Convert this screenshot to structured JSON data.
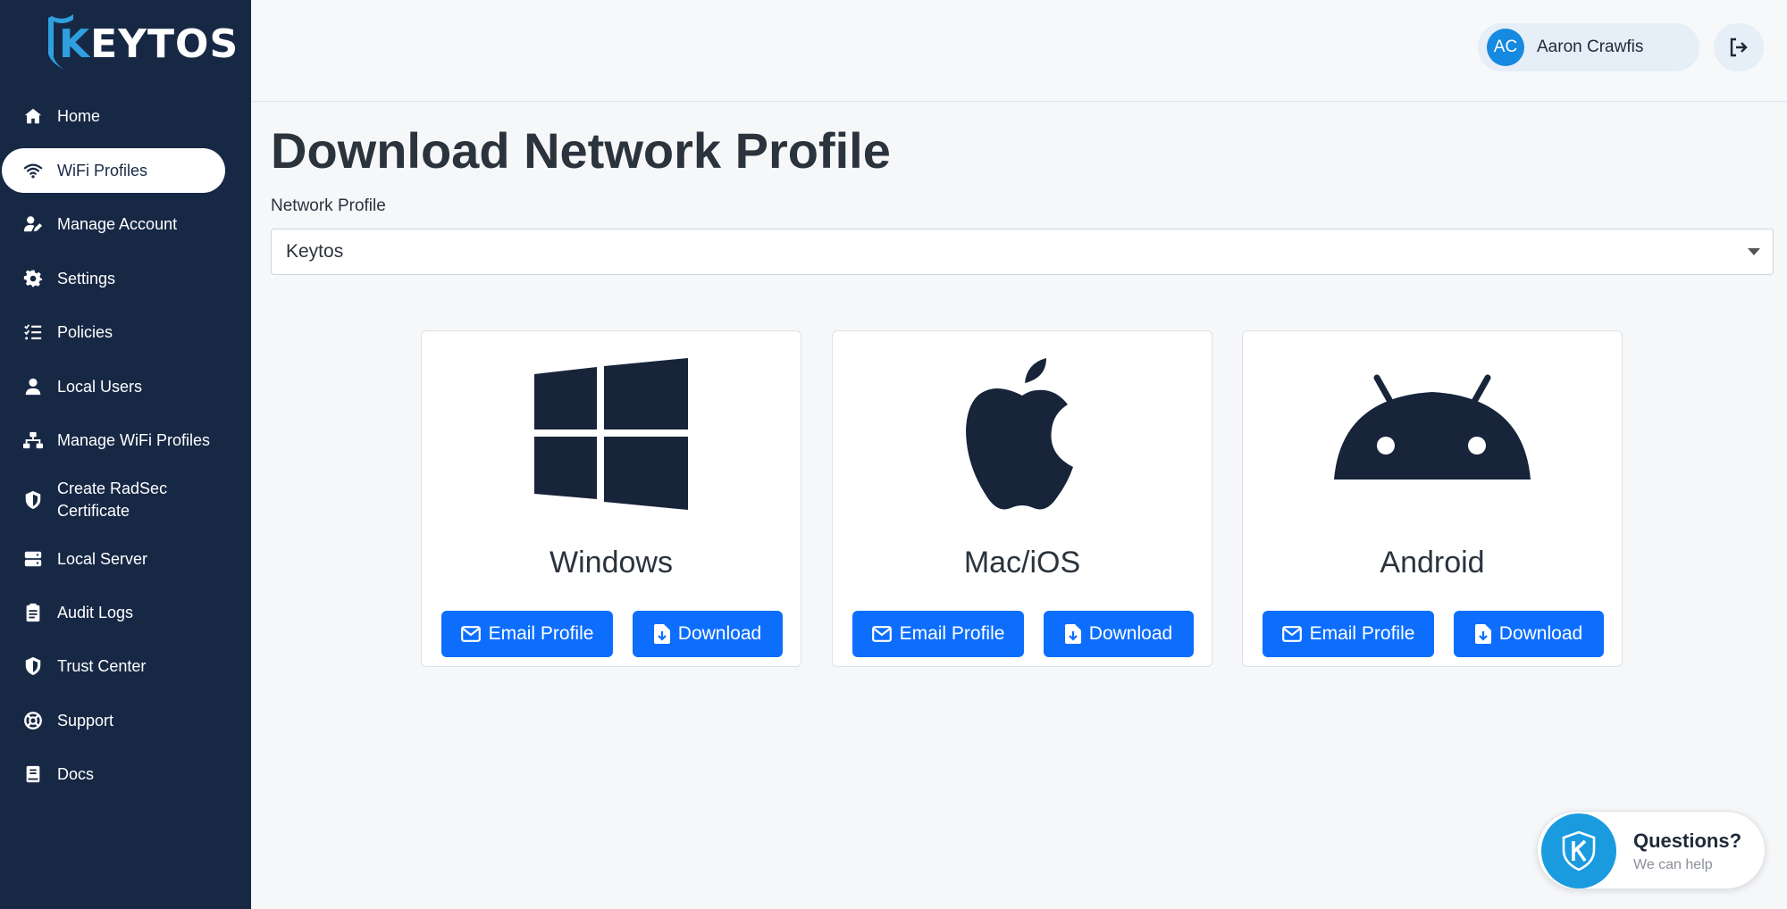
{
  "brand": {
    "name_k": "K",
    "name_rest": "EYTOS"
  },
  "sidebar": {
    "items": [
      {
        "label": "Home",
        "icon": "home-icon",
        "active": false
      },
      {
        "label": "WiFi Profiles",
        "icon": "wifi-icon",
        "active": true
      },
      {
        "label": "Manage Account",
        "icon": "user-edit-icon",
        "active": false
      },
      {
        "label": "Settings",
        "icon": "gear-icon",
        "active": false
      },
      {
        "label": "Policies",
        "icon": "list-check-icon",
        "active": false
      },
      {
        "label": "Local Users",
        "icon": "user-icon",
        "active": false
      },
      {
        "label": "Manage WiFi Profiles",
        "icon": "network-icon",
        "active": false
      },
      {
        "label": "Create RadSec\nCertificate",
        "icon": "shield-half-icon",
        "active": false
      },
      {
        "label": "Local Server",
        "icon": "server-icon",
        "active": false
      },
      {
        "label": "Audit Logs",
        "icon": "clipboard-icon",
        "active": false
      },
      {
        "label": "Trust Center",
        "icon": "shield-icon",
        "active": false
      },
      {
        "label": "Support",
        "icon": "life-ring-icon",
        "active": false
      },
      {
        "label": "Docs",
        "icon": "book-icon",
        "active": false
      }
    ]
  },
  "header": {
    "user_initials": "AC",
    "user_name": "Aaron Crawfis",
    "logout_icon": "logout-icon"
  },
  "main": {
    "title": "Download Network Profile",
    "profile_label": "Network Profile",
    "profile_selected": "Keytos",
    "platforms": [
      {
        "name": "Windows",
        "icon": "windows-icon",
        "email_label": "Email Profile",
        "download_label": "Download"
      },
      {
        "name": "Mac/iOS",
        "icon": "apple-icon",
        "email_label": "Email Profile",
        "download_label": "Download"
      },
      {
        "name": "Android",
        "icon": "android-icon",
        "email_label": "Email Profile",
        "download_label": "Download"
      }
    ]
  },
  "chat": {
    "title": "Questions?",
    "subtitle": "We can help"
  },
  "colors": {
    "sidebar": "#172845",
    "primary": "#0d6efd",
    "accent": "#1a9be0"
  }
}
